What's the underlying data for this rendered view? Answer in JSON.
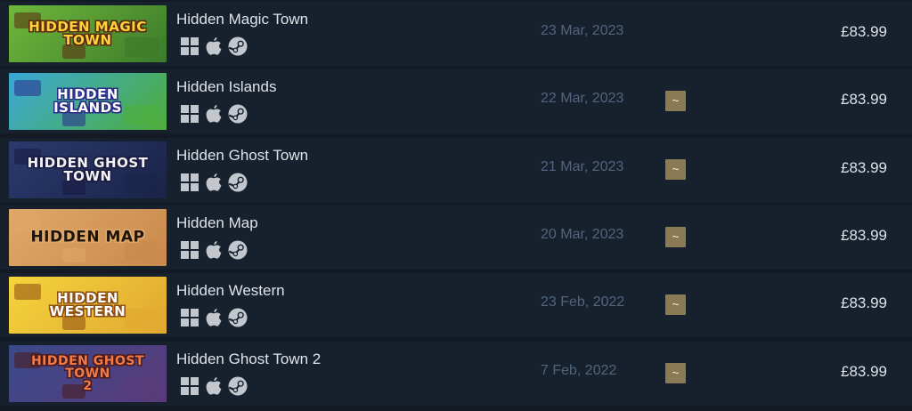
{
  "games": [
    {
      "title": "Hidden Magic Town",
      "logo_text": "HIDDEN MAGIC\nTOWN",
      "release_date": "23 Mar, 2023",
      "review_icon": "",
      "price": "£83.99",
      "platforms": [
        "windows-icon",
        "apple-icon",
        "steam-icon"
      ],
      "colors": {
        "bg": "#6fb83c",
        "bg2": "#3c7a2a",
        "logo": "#ffd23a",
        "stroke": "#5a2a10"
      }
    },
    {
      "title": "Hidden Islands",
      "logo_text": "HIDDEN\nISLANDS",
      "release_date": "22 Mar, 2023",
      "review_icon": "~",
      "price": "£83.99",
      "platforms": [
        "windows-icon",
        "apple-icon",
        "steam-icon"
      ],
      "colors": {
        "bg": "#3aa8d8",
        "bg2": "#4fae3a",
        "logo": "#ffffff",
        "stroke": "#2a2a8a"
      }
    },
    {
      "title": "Hidden Ghost Town",
      "logo_text": "HIDDEN GHOST\nTOWN",
      "release_date": "21 Mar, 2023",
      "review_icon": "~",
      "price": "£83.99",
      "platforms": [
        "windows-icon",
        "apple-icon",
        "steam-icon"
      ],
      "colors": {
        "bg": "#2a3a6e",
        "bg2": "#1a2448",
        "logo": "#f2f2f2",
        "stroke": "#1a1a40"
      }
    },
    {
      "title": "Hidden Map",
      "logo_text": "HIDDEN MAP",
      "release_date": "20 Mar, 2023",
      "review_icon": "~",
      "price": "£83.99",
      "platforms": [
        "windows-icon",
        "apple-icon",
        "steam-icon"
      ],
      "colors": {
        "bg": "#e0a868",
        "bg2": "#c88a4c",
        "logo": "#1e140c",
        "stroke": "#e0a868"
      }
    },
    {
      "title": "Hidden Western",
      "logo_text": "HIDDEN\nWESTERN",
      "release_date": "23 Feb, 2022",
      "review_icon": "~",
      "price": "£83.99",
      "platforms": [
        "windows-icon",
        "apple-icon",
        "steam-icon"
      ],
      "colors": {
        "bg": "#f4d43c",
        "bg2": "#e0a830",
        "logo": "#ffffff",
        "stroke": "#8a4a10"
      }
    },
    {
      "title": "Hidden Ghost Town 2",
      "logo_text": "HIDDEN GHOST\nTOWN\n2",
      "release_date": "7 Feb, 2022",
      "review_icon": "~",
      "price": "£83.99",
      "platforms": [
        "windows-icon",
        "apple-icon",
        "steam-icon"
      ],
      "colors": {
        "bg": "#3a4a8a",
        "bg2": "#5a3a7a",
        "logo": "#f07a4a",
        "stroke": "#4a1a1a"
      }
    }
  ]
}
